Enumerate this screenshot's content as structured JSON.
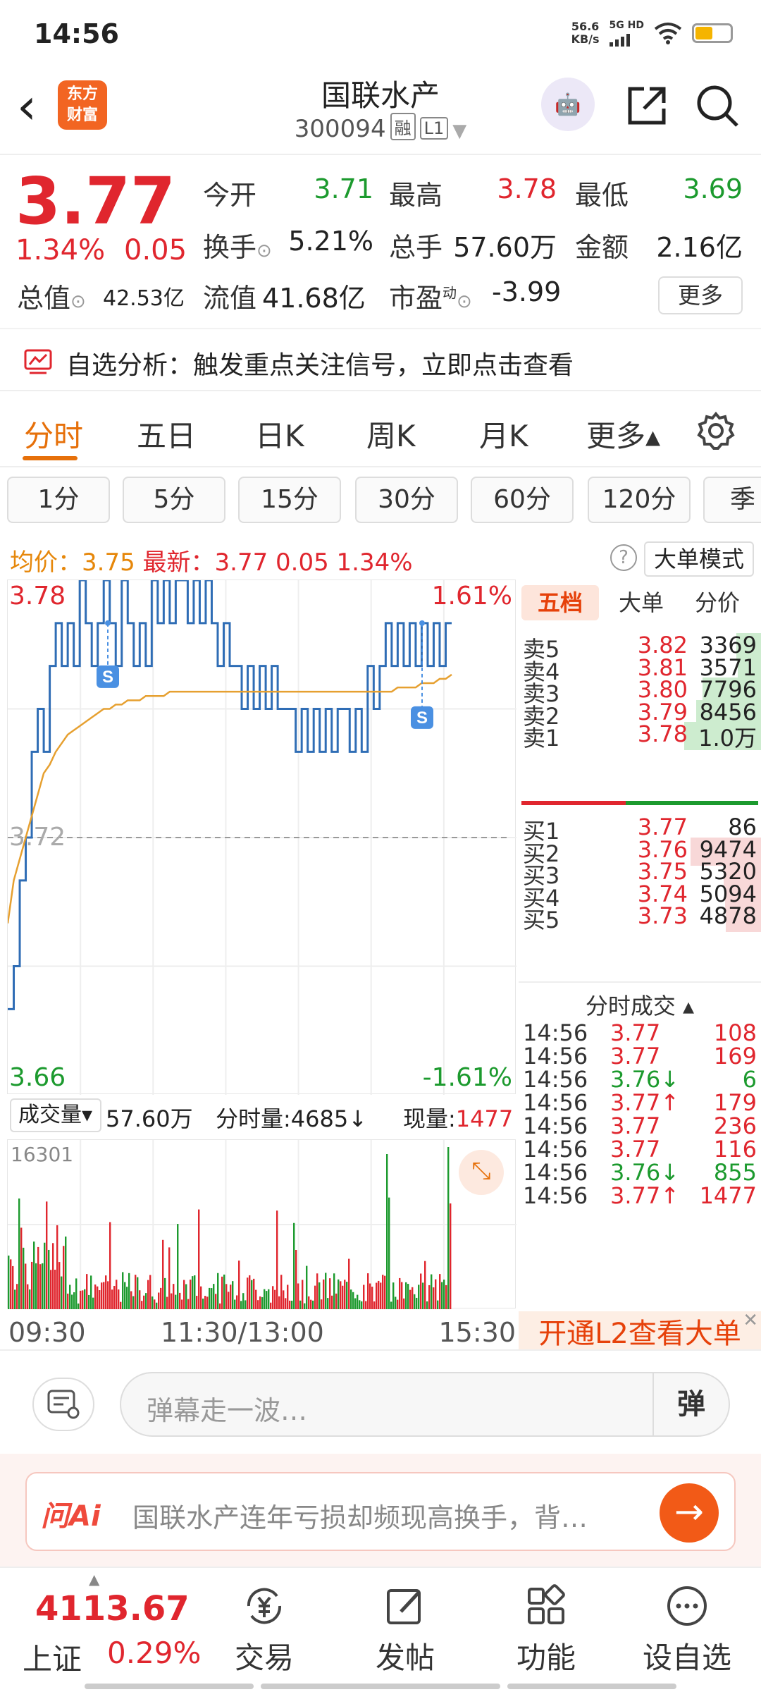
{
  "status_bar": {
    "time": "14:56",
    "speed_value": "56.6",
    "speed_unit": "KB/s",
    "network": "5G HD"
  },
  "header": {
    "logo_text_1": "东方",
    "logo_text_2": "财富",
    "stock_name": "国联水产",
    "stock_code": "300094",
    "tag_1": "融",
    "tag_2": "L1"
  },
  "quote": {
    "price": "3.77",
    "change_pct": "1.34%",
    "change_amt": "0.05",
    "open_label": "今开",
    "open": "3.71",
    "high_label": "最高",
    "high": "3.78",
    "low_label": "最低",
    "low": "3.69",
    "turnover_label": "换手",
    "turnover": "5.21%",
    "volume_label": "总手",
    "volume": "57.60万",
    "amount_label": "金额",
    "amount": "2.16亿",
    "mktcap_label": "总值",
    "mktcap": "42.53亿",
    "float_label": "流值",
    "float": "41.68亿",
    "pe_label": "市盈",
    "pe_sup": "动",
    "pe": "-3.99",
    "more_label": "更多"
  },
  "analysis": {
    "text": "自选分析：触发重点关注信号，立即点击查看"
  },
  "tabs": [
    "分时",
    "五日",
    "日K",
    "周K",
    "月K",
    "更多▴"
  ],
  "periods": [
    "1分",
    "5分",
    "15分",
    "30分",
    "60分",
    "120分",
    "季"
  ],
  "avg_line": {
    "avg_label": "均价：",
    "avg": "3.75",
    "latest_label": "最新：",
    "latest": "3.77",
    "chg": "0.05",
    "pct": "1.34%",
    "help": "?",
    "big_mode": "大单模式"
  },
  "chart_data": {
    "type": "line",
    "title": "",
    "x_ticks": [
      "09:30",
      "11:30/13:00",
      "15:30"
    ],
    "y_max": "3.78",
    "y_min": "3.66",
    "y_ref": "3.72",
    "pct_max": "1.61%",
    "pct_min": "-1.61%",
    "ylim": [
      3.66,
      3.78
    ],
    "series": [
      {
        "values": [
          3.68,
          3.69,
          3.71,
          3.72,
          3.74,
          3.75,
          3.74,
          3.76,
          3.77,
          3.76,
          3.77,
          3.76,
          3.78,
          3.77,
          3.76,
          3.77,
          3.78,
          3.77,
          3.76,
          3.78,
          3.77,
          3.76,
          3.77,
          3.76,
          3.78,
          3.77,
          3.78,
          3.77,
          3.78,
          3.78,
          3.77,
          3.78,
          3.77,
          3.78,
          3.77,
          3.76,
          3.77,
          3.76,
          3.76,
          3.75,
          3.76,
          3.75,
          3.76,
          3.75,
          3.76,
          3.75,
          3.75,
          3.75,
          3.74,
          3.75,
          3.74,
          3.75,
          3.74,
          3.75,
          3.74,
          3.75,
          3.75,
          3.74,
          3.75,
          3.74,
          3.76,
          3.75,
          3.76,
          3.77,
          3.76,
          3.77,
          3.76,
          3.77,
          3.76,
          3.77,
          3.76,
          3.77,
          3.76,
          3.77,
          3.77
        ]
      },
      {
        "values": [
          3.7,
          3.71,
          3.715,
          3.72,
          3.725,
          3.73,
          3.735,
          3.737,
          3.74,
          3.742,
          3.744,
          3.745,
          3.746,
          3.747,
          3.748,
          3.749,
          3.75,
          3.75,
          3.751,
          3.751,
          3.752,
          3.752,
          3.752,
          3.753,
          3.753,
          3.753,
          3.753,
          3.754,
          3.754,
          3.754,
          3.754,
          3.754,
          3.754,
          3.754,
          3.754,
          3.754,
          3.754,
          3.754,
          3.754,
          3.754,
          3.754,
          3.754,
          3.754,
          3.754,
          3.754,
          3.754,
          3.754,
          3.754,
          3.754,
          3.754,
          3.754,
          3.754,
          3.754,
          3.754,
          3.754,
          3.754,
          3.754,
          3.754,
          3.754,
          3.754,
          3.754,
          3.754,
          3.754,
          3.754,
          3.754,
          3.755,
          3.755,
          3.755,
          3.755,
          3.756,
          3.756,
          3.756,
          3.757,
          3.757,
          3.758
        ]
      }
    ],
    "volume_max": "16301"
  },
  "volume_bar": {
    "label": "成交量▾",
    "total": "57.60万",
    "minute_label": "分时量:",
    "minute": "4685↓",
    "now_label": "现量:",
    "now": "1477"
  },
  "order_book": {
    "tabs": [
      "五档",
      "大单",
      "分价"
    ],
    "asks": [
      {
        "label": "卖5",
        "price": "3.82",
        "vol": "3369",
        "fill": 0.3
      },
      {
        "label": "卖4",
        "price": "3.81",
        "vol": "3571",
        "fill": 0.28
      },
      {
        "label": "卖3",
        "price": "3.80",
        "vol": "7796",
        "fill": 0.7
      },
      {
        "label": "卖2",
        "price": "3.79",
        "vol": "8456",
        "fill": 0.78
      },
      {
        "label": "卖1",
        "price": "3.78",
        "vol": "1.0万",
        "fill": 0.92
      }
    ],
    "bids": [
      {
        "label": "买1",
        "price": "3.77",
        "vol": "86",
        "fill": 0.0
      },
      {
        "label": "买2",
        "price": "3.76",
        "vol": "9474",
        "fill": 0.85
      },
      {
        "label": "买3",
        "price": "3.75",
        "vol": "5320",
        "fill": 0.45
      },
      {
        "label": "买4",
        "price": "3.74",
        "vol": "5094",
        "fill": 0.43
      },
      {
        "label": "买5",
        "price": "3.73",
        "vol": "4878",
        "fill": 0.42
      }
    ],
    "ticks_title": "分时成交 ▴",
    "ticks": [
      {
        "t": "14:56",
        "p": "3.77",
        "v": "108",
        "c": "red"
      },
      {
        "t": "14:56",
        "p": "3.77",
        "v": "169",
        "c": "red"
      },
      {
        "t": "14:56",
        "p": "3.76↓",
        "v": "6",
        "c": "green"
      },
      {
        "t": "14:56",
        "p": "3.77↑",
        "v": "179",
        "c": "red"
      },
      {
        "t": "14:56",
        "p": "3.77",
        "v": "236",
        "c": "red"
      },
      {
        "t": "14:56",
        "p": "3.77",
        "v": "116",
        "c": "red"
      },
      {
        "t": "14:56",
        "p": "3.76↓",
        "v": "855",
        "c": "green"
      },
      {
        "t": "14:56",
        "p": "3.77↑",
        "v": "1477",
        "c": "red"
      }
    ],
    "l2_banner": "开通L2查看大单"
  },
  "danmaku": {
    "placeholder": "弹幕走一波…",
    "send": "弹"
  },
  "ai": {
    "logo": "问Ai",
    "text": "国联水产连年亏损却频现高换手，背…",
    "go": "→"
  },
  "bottom_nav": {
    "index_value": "4113.67",
    "index_name": "上证",
    "index_pct": "0.29%",
    "items": [
      "交易",
      "发帖",
      "功能",
      "设自选"
    ]
  }
}
